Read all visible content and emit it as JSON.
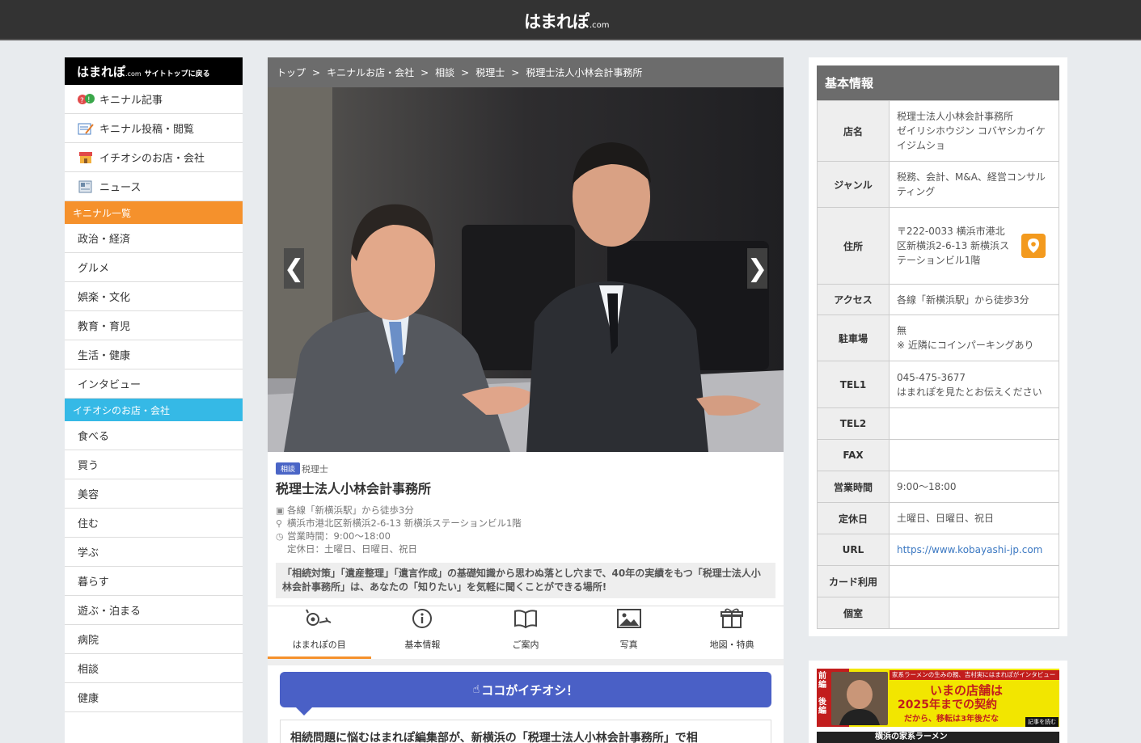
{
  "site": {
    "logo": "はまれぽ",
    "logo_suffix": ".com"
  },
  "sidebar": {
    "logo": "はまれぽ",
    "logo_suffix": ".com",
    "back_label": "サイトトップに戻る",
    "items": [
      {
        "label": "キニナル記事",
        "icon": "question-bubble-icon"
      },
      {
        "label": "キニナル投稿・閲覧",
        "icon": "memo-icon"
      },
      {
        "label": "イチオシのお店・会社",
        "icon": "shop-icon"
      },
      {
        "label": "ニュース",
        "icon": "newspaper-icon"
      }
    ],
    "kininaru_head": "キニナル一覧",
    "kininaru": [
      "政治・経済",
      "グルメ",
      "娯楽・文化",
      "教育・育児",
      "生活・健康",
      "インタビュー"
    ],
    "ichioshi_head": "イチオシのお店・会社",
    "ichioshi": [
      "食べる",
      "買う",
      "美容",
      "住む",
      "学ぶ",
      "暮らす",
      "遊ぶ・泊まる",
      "病院",
      "相談",
      "健康"
    ]
  },
  "breadcrumb": [
    "トップ",
    "キニナルお店・会社",
    "相談",
    "税理士",
    "税理士法人小林会計事務所"
  ],
  "breadcrumb_sep": ">",
  "slider": {
    "prev": "❮",
    "next": "❯"
  },
  "shop": {
    "tag": "相談",
    "genre": "税理士",
    "name": "税理士法人小林会計事務所",
    "access": "各線「新横浜駅」から徒歩3分",
    "address": "横浜市港北区新横浜2-6-13 新横浜ステーションビル1階",
    "hours": "営業時間：9:00〜18:00",
    "closed": "定休日：土曜日、日曜日、祝日",
    "desc": "「相続対策」「遺産整理」「遺言作成」の基礎知識から思わぬ落とし穴まで、40年の実績をもつ「税理士法人小林会計事務所」は、あなたの「知りたい」を気軽に聞くことができる場所!"
  },
  "tabs": [
    {
      "label": "はまれぽの目",
      "icon": "eye-icon"
    },
    {
      "label": "基本情報",
      "icon": "info-icon"
    },
    {
      "label": "ご案内",
      "icon": "book-icon"
    },
    {
      "label": "写真",
      "icon": "photo-icon"
    },
    {
      "label": "地図・特典",
      "icon": "gift-icon"
    }
  ],
  "ichioshi_label": "ココがイチオシ！",
  "body_text": "相続問題に悩むはまれぽ編集部が、新横浜の「税理士法人小林会計事務所」で相",
  "kihon": {
    "head": "基本情報",
    "rows": [
      {
        "k": "店名",
        "v": "税理士法人小林会計事務所\nゼイリシホウジン コバヤシカイケイジムショ"
      },
      {
        "k": "ジャンル",
        "v": "税務、会計、M&A、経営コンサルティング"
      },
      {
        "k": "住所",
        "v": "〒222-0033 横浜市港北区新横浜2-6-13 新横浜ステーションビル1階"
      },
      {
        "k": "アクセス",
        "v": "各線「新横浜駅」から徒歩3分"
      },
      {
        "k": "駐車場",
        "v": "無\n※ 近隣にコインパーキングあり"
      },
      {
        "k": "TEL1",
        "v": "045-475-3677\nはまれぽを見たとお伝えください"
      },
      {
        "k": "TEL2",
        "v": ""
      },
      {
        "k": "FAX",
        "v": ""
      },
      {
        "k": "営業時間",
        "v": "9:00〜18:00"
      },
      {
        "k": "定休日",
        "v": "土曜日、日曜日、祝日"
      },
      {
        "k": "URL",
        "v": "https://www.kobayashi-jp.com"
      },
      {
        "k": "カード利用",
        "v": ""
      },
      {
        "k": "個室",
        "v": ""
      }
    ]
  },
  "banner": {
    "tag_left": "前編",
    "tag_left2": "後編",
    "header": "家系ラーメンの生みの親、吉村実にはまれぽがインタビュー",
    "headline": "いまの店舗は",
    "sub": "2025年までの契約",
    "line3": "だから、移転は3年後だな",
    "read": "記事を読む",
    "bottom": "横浜の家系ラーメン"
  }
}
